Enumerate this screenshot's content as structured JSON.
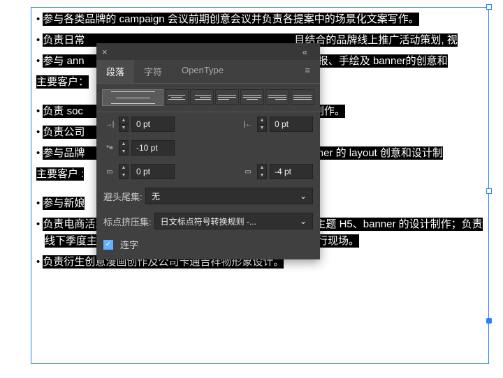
{
  "items": [
    "参与各类品牌的 campaign 会议前期创意会议并负责各提案中的场景化文案写作。",
    "负责日常　　　　　　　　　　　　　　　　　　　　目结合的品牌线上推广活动策划, 视",
    "参与 ann　　　　　　　　　　　　　　　　　　　H5、海报、手绘及 banner的创意和",
    "",
    "负责 soc　　　　　　　　　　　　　　　　　　　和设计制作。",
    "负责公司　　　　　　　　　　　　　　　　　　　",
    "参与品牌　　　　　　　　　　　　　　　　　　　 和 banner 的 layout 创意和设计制",
    "",
    "参与新娘",
    "负责电商活动推广中视觉创意及活动交互内容、相关网页、主题 H5、banner 的设计制作；负责线下季度主题活动海报等印刷物料的设计制作并参与展会执行现场。",
    "负责衍生创意漫画创作及公司卡通吉祥物形象设计。"
  ],
  "hdrs": {
    "a": "主要客户：",
    "b": "主要客户 :"
  },
  "panel": {
    "closeX": "×",
    "collapse": "«",
    "menu": "≡",
    "tabs": [
      "段落",
      "字符",
      "OpenType"
    ],
    "left": "0 pt",
    "right": "0 pt",
    "firstline": "-10 pt",
    "before": "0 pt",
    "after": "-4 pt",
    "kinsokuLbl": "避头尾集:",
    "kinsokuVal": "无",
    "mojiLbl": "标点挤压集:",
    "mojiVal": "日文标点符号转换规则 -...",
    "liga": "连字"
  }
}
